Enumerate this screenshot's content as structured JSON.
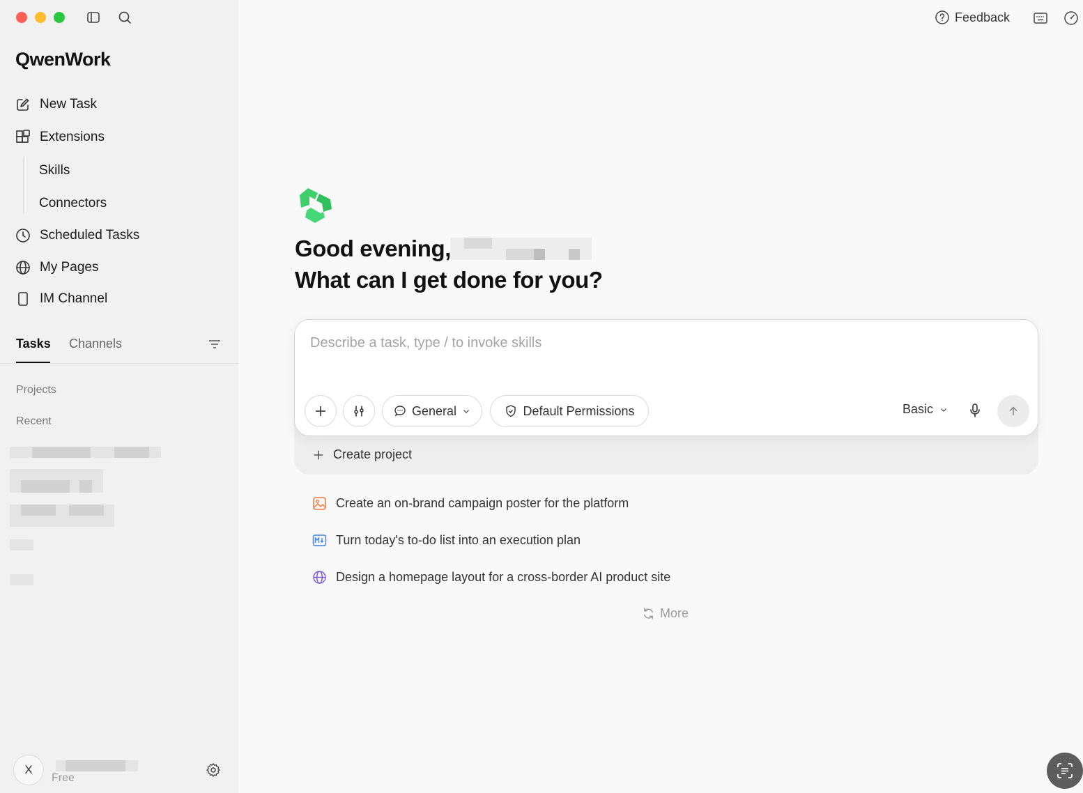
{
  "app": {
    "brand": "QwenWork"
  },
  "sidebar": {
    "nav": [
      {
        "label": "New Task",
        "icon": "edit-icon"
      },
      {
        "label": "Extensions",
        "icon": "extensions-icon"
      }
    ],
    "extensions_sub": [
      "Skills",
      "Connectors"
    ],
    "nav2": [
      {
        "label": "Scheduled Tasks",
        "icon": "clock-icon"
      },
      {
        "label": "My Pages",
        "icon": "globe-icon"
      },
      {
        "label": "IM Channel",
        "icon": "phone-icon"
      }
    ],
    "tabs": [
      "Tasks",
      "Channels"
    ],
    "sections": {
      "projects": "Projects",
      "recent": "Recent"
    },
    "user": {
      "avatar_initial": "X",
      "plan": "Free"
    }
  },
  "header": {
    "feedback_label": "Feedback"
  },
  "main": {
    "greeting_line1": "Good evening,",
    "greeting_line2": "What can I get done for you?",
    "composer": {
      "placeholder": "Describe a task, type / to invoke skills",
      "value": "",
      "mode_label": "General",
      "permissions_label": "Default Permissions",
      "model_label": "Basic"
    },
    "create_project_label": "Create project",
    "suggestions": [
      {
        "label": "Create an on-brand campaign poster for the platform",
        "icon": "image-icon",
        "color": "#f07b3f"
      },
      {
        "label": "Turn today's to-do list into an execution plan",
        "icon": "markdown-icon",
        "color": "#3b82f6"
      },
      {
        "label": "Design a homepage layout for a cross-border AI product site",
        "icon": "globe-icon",
        "color": "#7c5cd6"
      }
    ],
    "more_label": "More"
  },
  "colors": {
    "accent_green": "#2ecc71",
    "sidebar_bg": "#f1f1f1",
    "main_bg": "#f9f9f9"
  }
}
